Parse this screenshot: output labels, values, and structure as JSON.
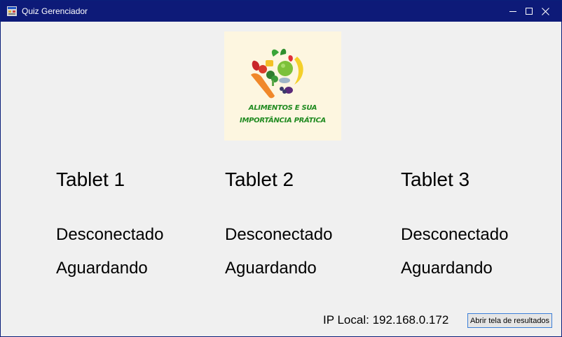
{
  "window": {
    "title": "Quiz Gerenciador"
  },
  "logo": {
    "line1": "ALIMENTOS E SUA",
    "line2": "IMPORTÂNCIA PRÁTICA"
  },
  "tablets": [
    {
      "name": "Tablet 1",
      "connection": "Desconectado",
      "state": "Aguardando"
    },
    {
      "name": "Tablet 2",
      "connection": "Desconectado",
      "state": "Aguardando"
    },
    {
      "name": "Tablet 3",
      "connection": "Desconectado",
      "state": "Aguardando"
    }
  ],
  "footer": {
    "ip_label": "IP Local: 192.168.0.172",
    "results_button": "Abrir tela de resultados"
  },
  "colors": {
    "titlebar": "#0d1a78",
    "client": "#f0f0f0",
    "logo_bg": "#fdf6e0",
    "logo_text": "#1f8a1f"
  }
}
